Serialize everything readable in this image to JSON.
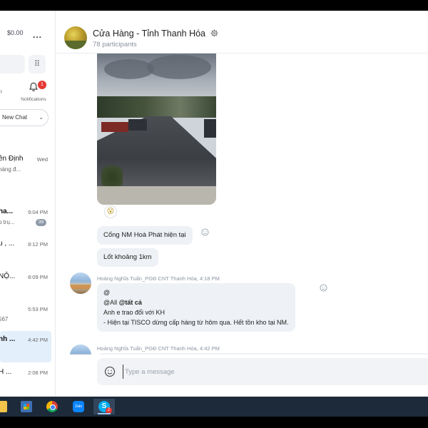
{
  "sidebar": {
    "balance": "$0.00",
    "more": "...",
    "dialpad_icon": "dialpad-icon",
    "notifications": {
      "label": "Notifications",
      "badge": "1"
    },
    "new_chat_label": "New Chat",
    "chats": [
      {
        "name": "ền Định",
        "time": "Wed",
        "preview": "hàng đ...",
        "bold": false
      },
      {
        "name": "ha...",
        "time": "9:04 PM",
        "preview": "o trụ...",
        "count": "39",
        "bold": true
      },
      {
        "name": "u , ...",
        "time": "8:12 PM",
        "preview": "",
        "bold": false
      },
      {
        "name": "NỘ...",
        "time": "8:09 PM",
        "preview": "",
        "bold": false
      },
      {
        "name": "",
        "time": "5:53 PM",
        "preview": "567",
        "bold": false
      },
      {
        "name": "nh ...",
        "time": "4:42 PM",
        "preview": "",
        "bold": true,
        "active": true
      },
      {
        "name": "H ...",
        "time": "2:08 PM",
        "preview": "",
        "bold": false
      }
    ]
  },
  "header": {
    "title": "Cửa Hàng - Tỉnh Thanh Hóa",
    "participants": "78 participants"
  },
  "messages": {
    "reaction": "😮",
    "bubble1": "Cổng NM Hoà Phát hiện tại",
    "bubble2": "Lốt khoảng 1km",
    "msg1": {
      "sender": "Hoàng Nghĩa Tuấn_PGĐ CNT Thanh Hóa, 4:18 PM",
      "line1": "@",
      "line2_prefix": "@All ",
      "line2_mention": "@tất cả",
      "line3": "Anh e trao đổi với KH",
      "line4": "- Hiện tại TISCO dừng cấp hàng từ hôm qua. Hết tồn kho tại NM."
    },
    "msg2": {
      "sender": "Hoàng Nghĩa Tuấn_PGĐ CNT Thanh Hóa, 4:42 PM",
      "line1": "@"
    }
  },
  "composer": {
    "placeholder": "Type a message"
  },
  "taskbar": {
    "zalo_label": "Zalo",
    "skype_letter": "S",
    "skype_badge": "2"
  },
  "colors": {
    "accent": "#00aff0",
    "badge": "#e53935",
    "active_chat": "#e3f0fb",
    "taskbar": "#1d2a3a"
  }
}
